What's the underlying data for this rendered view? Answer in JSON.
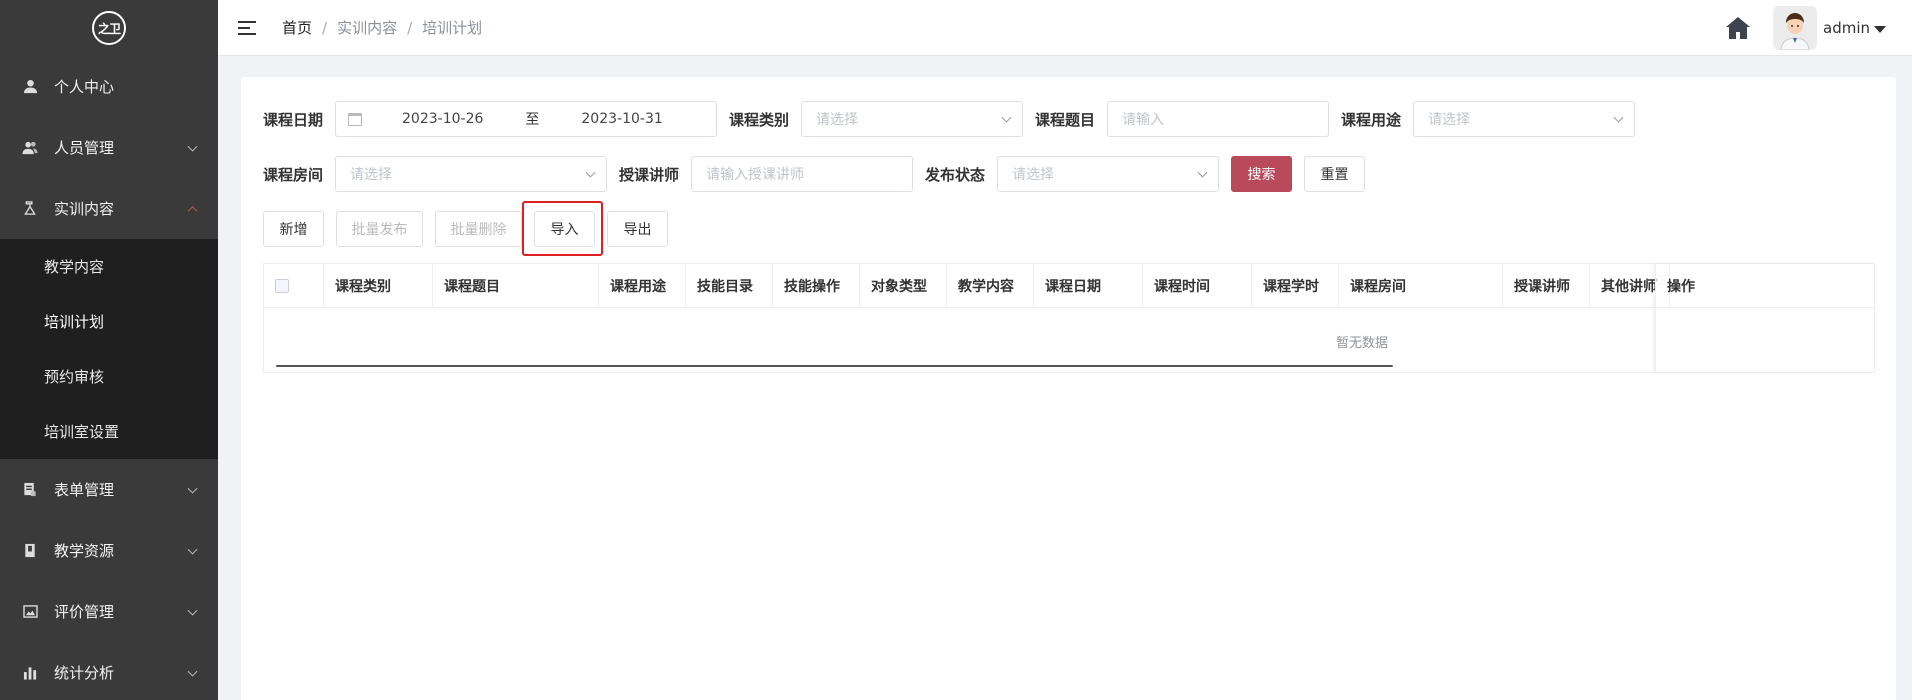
{
  "sidebar": {
    "logo_text": "之卫",
    "items": [
      {
        "label": "个人中心",
        "icon": "user-icon"
      },
      {
        "label": "人员管理",
        "icon": "users-icon"
      },
      {
        "label": "实训内容",
        "icon": "flask-icon"
      }
    ],
    "submenu": [
      "教学内容",
      "培训计划",
      "预约审核",
      "培训室设置"
    ],
    "items_after": [
      {
        "label": "表单管理",
        "icon": "form-icon"
      },
      {
        "label": "教学资源",
        "icon": "book-icon"
      },
      {
        "label": "评价管理",
        "icon": "image-icon"
      },
      {
        "label": "统计分析",
        "icon": "bar-chart-icon"
      }
    ]
  },
  "header": {
    "breadcrumb": [
      "首页",
      "实训内容",
      "培训计划"
    ],
    "username": "admin"
  },
  "filters": {
    "course_date_label": "课程日期",
    "date_start": "2023-10-26",
    "date_to": "至",
    "date_end": "2023-10-31",
    "course_type_label": "课程类别",
    "course_type_placeholder": "请选择",
    "course_topic_label": "课程题目",
    "course_topic_placeholder": "请输入",
    "course_use_label": "课程用途",
    "course_use_placeholder": "请选择",
    "course_room_label": "课程房间",
    "course_room_placeholder": "请选择",
    "teacher_label": "授课讲师",
    "teacher_placeholder": "请输入授课讲师",
    "publish_status_label": "发布状态",
    "publish_status_placeholder": "请选择",
    "search_label": "搜索",
    "reset_label": "重置"
  },
  "toolbar": {
    "add": "新增",
    "batch_publish": "批量发布",
    "batch_delete": "批量删除",
    "import": "导入",
    "export": "导出"
  },
  "table": {
    "columns": [
      "课程类别",
      "课程题目",
      "课程用途",
      "技能目录",
      "技能操作",
      "对象类型",
      "教学内容",
      "课程日期",
      "课程时间",
      "课程学时",
      "课程房间",
      "授课讲师",
      "其他讲师"
    ],
    "action_column": "操作",
    "empty_text": "暂无数据"
  },
  "colors": {
    "sidebar_bg": "#3a3a3a",
    "submenu_bg": "#1f1f1f",
    "primary": "#b84a5c",
    "highlight": "#e02020"
  }
}
